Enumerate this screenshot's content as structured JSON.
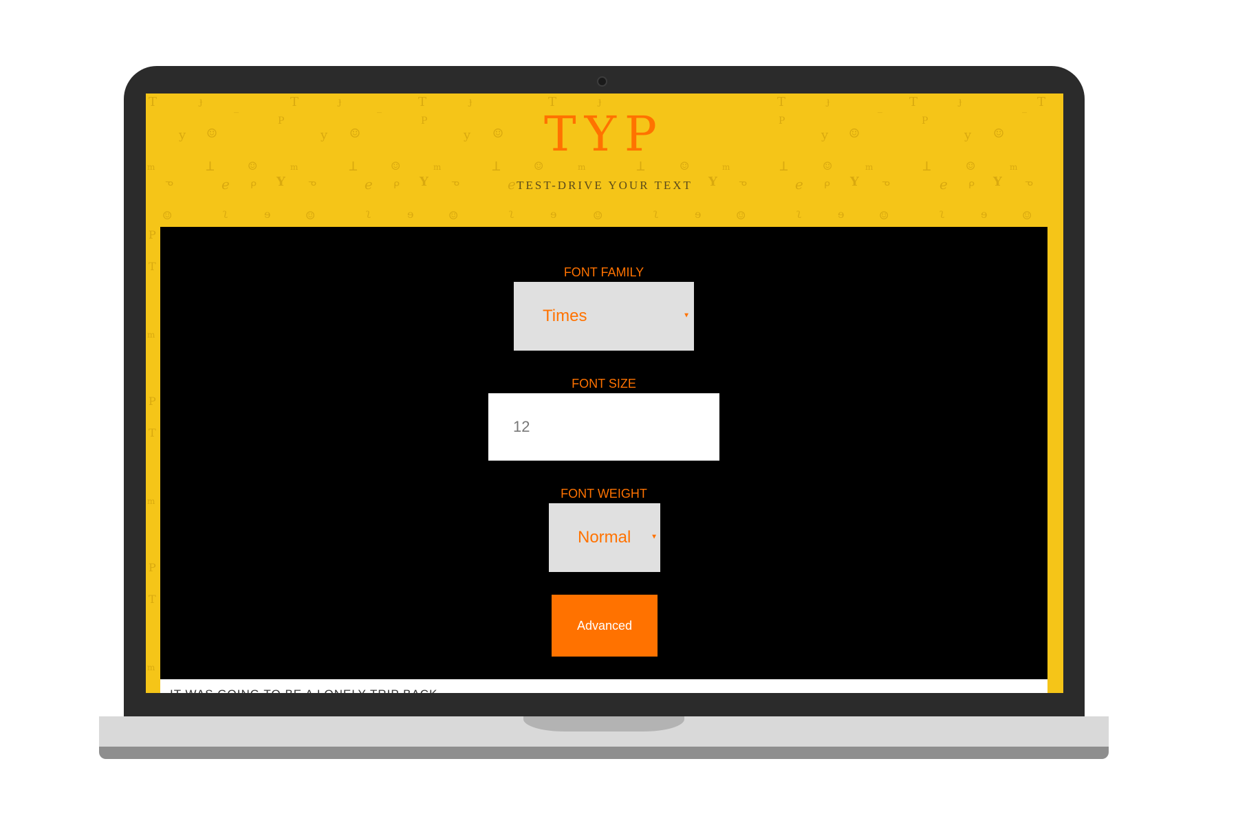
{
  "app": {
    "title": "TYP",
    "tagline": "TEST-DRIVE YOUR TEXT"
  },
  "controls": {
    "font_family": {
      "label": "FONT FAMILY",
      "value": "Times"
    },
    "font_size": {
      "label": "FONT SIZE",
      "value": "12"
    },
    "font_weight": {
      "label": "FONT WEIGHT",
      "value": "Normal"
    },
    "advanced_label": "Advanced"
  },
  "preview": {
    "text": "IT WAS GOING TO BE A LONELY TRIP BACK."
  },
  "colors": {
    "background": "#f5c518",
    "accent": "#ff7200",
    "panel": "#000000",
    "select_bg": "#e0e0e0"
  },
  "icons": {
    "select_caret": "caret-down-icon",
    "camera": "camera-icon"
  }
}
